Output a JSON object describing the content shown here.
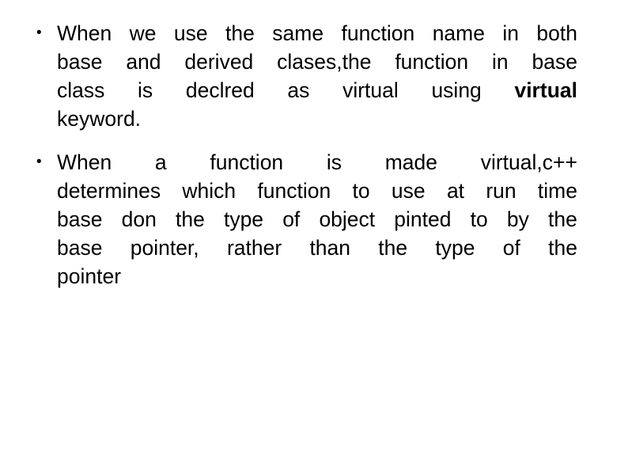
{
  "slide": {
    "background_color": "#ffffff",
    "text_color": "#000000",
    "bullet_glyph": "•",
    "bullets": [
      {
        "id": "bullet-1",
        "full_text": "When we use the same function name in both base and derived clases,the function in base class is declred as virtual using virtual keyword.",
        "lines": [
          {
            "align": "justify",
            "words": [
              "When",
              "we",
              "use",
              "the",
              "same",
              "function",
              "name",
              "in",
              "both"
            ]
          },
          {
            "align": "justify",
            "words": [
              "base",
              "and",
              "derived",
              "clases,the",
              "function",
              "in",
              "base"
            ]
          },
          {
            "align": "justify",
            "words": [
              "class",
              "is",
              "declred",
              "as",
              "virtual",
              "using",
              "virtual"
            ],
            "bold_indices": [
              6
            ]
          },
          {
            "align": "left",
            "words": [
              "keyword."
            ]
          }
        ]
      },
      {
        "id": "bullet-2",
        "full_text": "When a function is made virtual,c++ determines which function to use at run time base don the type of object pinted to by the base pointer, rather than the type of the pointer",
        "lines": [
          {
            "align": "justify",
            "words": [
              "When",
              "a",
              "function",
              "is",
              "made",
              "virtual,c++"
            ]
          },
          {
            "align": "justify",
            "words": [
              "determines",
              "which",
              "function",
              "to",
              "use",
              "at",
              "run",
              "time"
            ]
          },
          {
            "align": "justify",
            "words": [
              "base",
              "don",
              "the",
              "type",
              "of",
              "object",
              "pinted",
              "to",
              "by",
              "the"
            ]
          },
          {
            "align": "justify",
            "words": [
              "base",
              "pointer,",
              "rather",
              "than",
              "the",
              "type",
              "of",
              "the"
            ]
          },
          {
            "align": "left",
            "words": [
              "pointer"
            ]
          }
        ]
      }
    ]
  }
}
